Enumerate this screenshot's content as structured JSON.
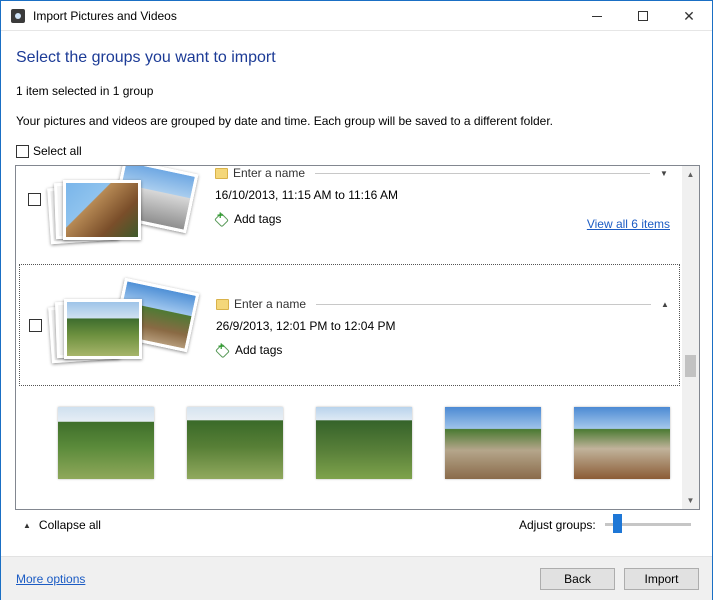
{
  "window": {
    "title": "Import Pictures and Videos",
    "minimize_icon": "minimize-icon",
    "maximize_icon": "maximize-icon",
    "close_icon": "close-icon"
  },
  "header": {
    "heading": "Select the groups you want to import",
    "selected_info": "1 item selected in 1 group",
    "description": "Your pictures and videos are grouped by date and time. Each group will be saved to a different folder.",
    "select_all_label": "Select all",
    "select_all_checked": false
  },
  "groups": [
    {
      "checked": false,
      "name_placeholder": "Enter a name",
      "date_range": "16/10/2013, 11:15 AM to 11:16 AM",
      "add_tags_label": "Add tags",
      "view_all_label": "View all 6 items",
      "expanded": false,
      "expand_icon": "chevron-down-icon"
    },
    {
      "checked": false,
      "name_placeholder": "Enter a name",
      "date_range": "26/9/2013, 12:01 PM to 12:04 PM",
      "add_tags_label": "Add tags",
      "expanded": true,
      "expand_icon": "chevron-up-icon",
      "preview_count": 5
    }
  ],
  "footer": {
    "collapse_all_label": "Collapse all",
    "adjust_groups_label": "Adjust groups:",
    "adjust_groups_level": 0.1
  },
  "bottom": {
    "more_options_label": "More options",
    "back_label": "Back",
    "import_label": "Import"
  },
  "colors": {
    "accent": "#1c3b96",
    "link": "#1c5cc4",
    "slider": "#1e77d6",
    "border": "#1a6fc4"
  }
}
